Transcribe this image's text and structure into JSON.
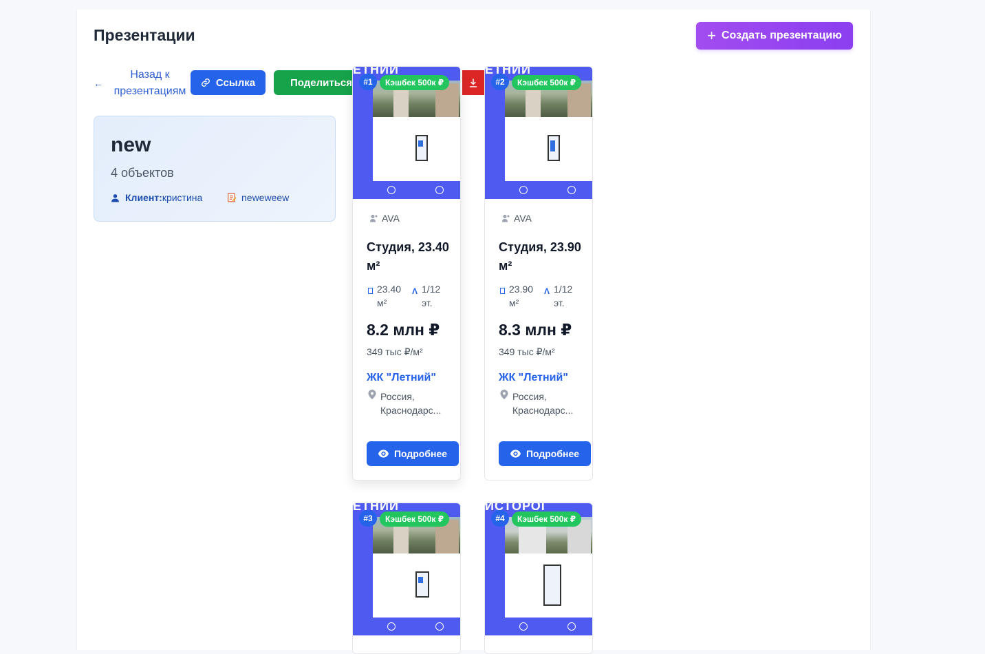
{
  "header": {
    "title": "Презентации",
    "create_button": "Создать презентацию"
  },
  "toolbar": {
    "back_label": "Назад к презентациям",
    "link_label": "Ссылка",
    "share_label": "Поделиться"
  },
  "presentation": {
    "name": "new",
    "count": "4 объектов",
    "client_label": "Клиент:",
    "client_name": "кристина",
    "note": "neweweew"
  },
  "cards": [
    {
      "num": "#1",
      "cashback": "Кэшбек 500к ₽",
      "developer": "AVA",
      "title": "Студия, 23.40 м²",
      "area": "23.40 м²",
      "floor": "1/12 эт.",
      "price": "8.2 млн ₽",
      "price_per_m": "349 тыс ₽/м²",
      "complex": "ЖК \"Летний\"",
      "address": "Россия, Краснодарс...",
      "details_label": "Подробнее"
    },
    {
      "num": "#2",
      "cashback": "Кэшбек 500к ₽",
      "developer": "AVA",
      "title": "Студия, 23.90 м²",
      "area": "23.90 м²",
      "floor": "1/12 эт.",
      "price": "8.3 млн ₽",
      "price_per_m": "349 тыс ₽/м²",
      "complex": "ЖК \"Летний\"",
      "address": "Россия, Краснодарс...",
      "details_label": "Подробнее"
    },
    {
      "num": "#3",
      "cashback": "Кэшбек 500к ₽"
    },
    {
      "num": "#4",
      "cashback": "Кэшбек 500к ₽"
    }
  ],
  "colors": {
    "primary": "#2563eb",
    "success": "#16a34a",
    "danger": "#dc2626",
    "accent": "#9b4cf0",
    "thumb_bg": "#4f5af0"
  }
}
